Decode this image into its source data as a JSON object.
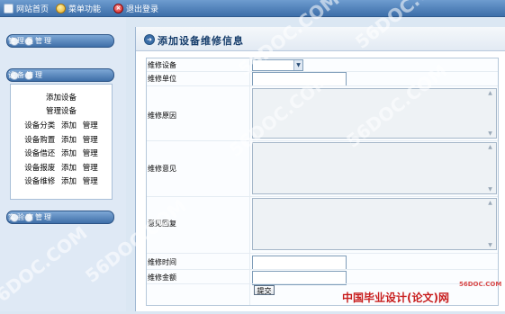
{
  "toolbar": {
    "items": [
      {
        "label": "网站首页",
        "icon": "home-icon"
      },
      {
        "label": "菜单功能",
        "icon": "star-icon"
      },
      {
        "label": "退出登录",
        "icon": "exit-icon"
      }
    ]
  },
  "sidebar": {
    "sections": [
      {
        "label": "管理员管理"
      },
      {
        "label": "设备管理"
      },
      {
        "label": "实验室管理"
      }
    ],
    "menu": [
      {
        "label": "添加设备"
      },
      {
        "label": "管理设备"
      },
      {
        "label": "设备分类",
        "add": "添加",
        "manage": "管理"
      },
      {
        "label": "设备购置",
        "add": "添加",
        "manage": "管理"
      },
      {
        "label": "设备借还",
        "add": "添加",
        "manage": "管理"
      },
      {
        "label": "设备报废",
        "add": "添加",
        "manage": "管理"
      },
      {
        "label": "设备维修",
        "add": "添加",
        "manage": "管理"
      }
    ]
  },
  "main": {
    "title": "添加设备维修信息",
    "form": {
      "device_label": "维修设备",
      "unit_label": "维修单位",
      "reason_label": "维修原因",
      "opinion_label": "维修意见",
      "reply_label": "意见回复",
      "time_label": "维修时间",
      "amount_label": "维修金额",
      "device_value": "",
      "unit_value": "",
      "reason_value": "",
      "opinion_value": "",
      "reply_value": "",
      "time_value": "",
      "amount_value": "",
      "submit_label": "提交"
    }
  },
  "watermark": {
    "text": "56DOC.COM",
    "logo": "中国毕业设计(论文)网",
    "logo_small": "56DOC.COM"
  }
}
